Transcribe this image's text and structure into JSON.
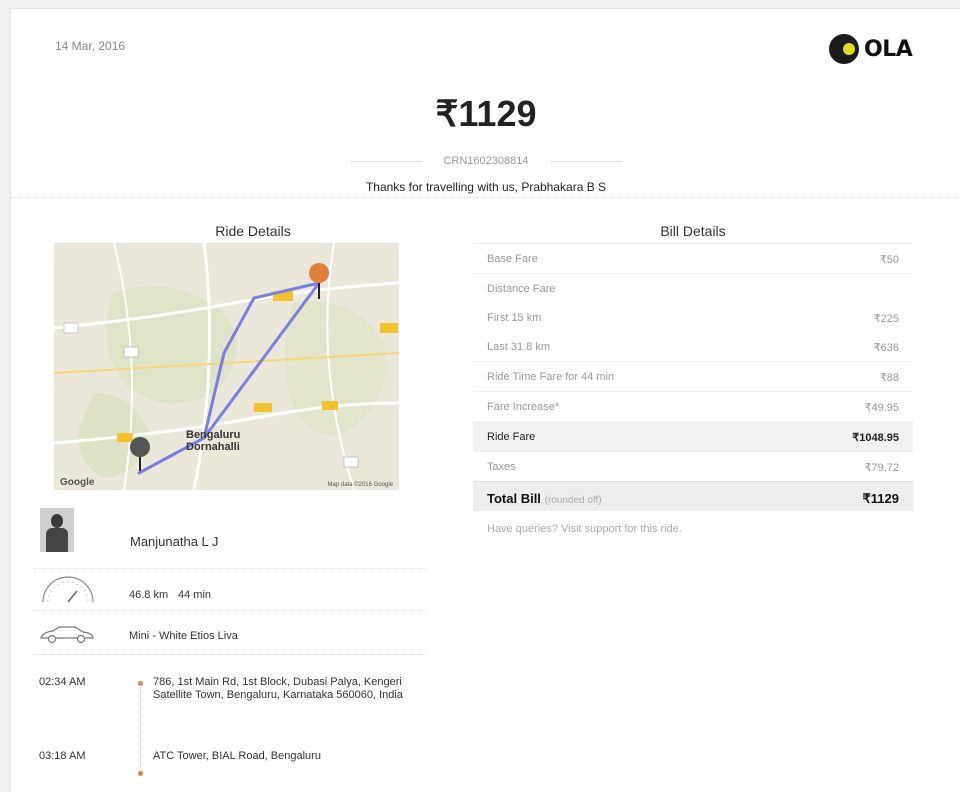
{
  "header": {
    "date": "14 Mar, 2016",
    "brand": "OLA",
    "amount": "₹1129",
    "crn": "CRN1602308814",
    "thanks": "Thanks for travelling with us, Prabhakara B S"
  },
  "sections": {
    "ride_title": "Ride Details",
    "bill_title": "Bill Details"
  },
  "map": {
    "city_label": "Bengaluru",
    "city_label2": "Dornahalli",
    "google": "Google",
    "copyright": "Map data ©2016 Google",
    "route_color": "#7b7fe0",
    "pin_start_color": "#555555",
    "pin_end_color": "#e0803a"
  },
  "driver": {
    "name": "Manjunatha L J"
  },
  "ride_stats": {
    "distance": "46.8 km",
    "duration": "44 min"
  },
  "vehicle": {
    "text": "Mini - White Etios Liva"
  },
  "trip": {
    "pickup_time": "02:34 AM",
    "pickup_address": "786, 1st Main Rd, 1st Block, Dubasi Palya, Kengeri Satellite Town, Bengaluru, Karnataka 560060, India",
    "drop_time": "03:18 AM",
    "drop_address": "ATC Tower, BIAL Road, Bengaluru",
    "pickup_color": "#e0803a",
    "drop_color": "#e0803a"
  },
  "bill": {
    "rows": [
      {
        "label": "Base Fare",
        "value": "₹50"
      },
      {
        "label": "Distance Fare",
        "value": ""
      },
      {
        "label": "First 15 km",
        "value": "₹225"
      },
      {
        "label": "Last 31.8 km",
        "value": "₹636"
      },
      {
        "label": "Ride Time Fare for 44 min",
        "value": "₹88"
      },
      {
        "label": "Fare Increase*",
        "value": "₹49.95"
      },
      {
        "label": "Ride Fare",
        "value": "₹1048.95"
      },
      {
        "label": "Taxes",
        "value": "₹79.72"
      }
    ],
    "total_label": "Total Bill",
    "total_note": "(rounded off)",
    "total_value": "₹1129",
    "queries": "Have queries? Visit support for this ride."
  }
}
